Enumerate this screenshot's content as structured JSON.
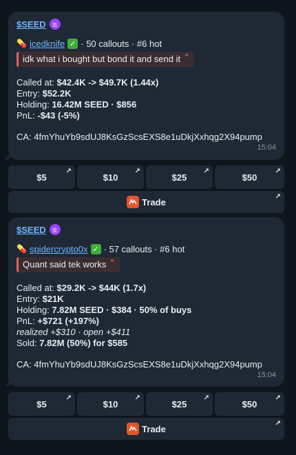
{
  "messages": [
    {
      "token": "$SEED",
      "caller_pill": "💊",
      "caller": "icedknife",
      "caller_stats": "· 50 callouts · #6 hot",
      "quote": "idk what i bought but bond it and send it",
      "quote_mark": "”",
      "called_label": "Called at:",
      "called_value": "$42.4K -> $49.7K (1.44x)",
      "entry_label": "Entry:",
      "entry_value": "$52.2K",
      "holding_label": "Holding:",
      "holding_value": "16.42M SEED · $856",
      "pnl_label": "PnL:",
      "pnl_value": "-$43 (-5%)",
      "ca": "CA: 4fmYhuYb9sdUJ8KsGzScsEXS8e1uDkjXxhqg2X94pump",
      "time": "15:04"
    },
    {
      "token": "$SEED",
      "caller_pill": "💊",
      "caller": "spidercrypto0x",
      "caller_stats": "· 57 callouts · #6 hot",
      "quote": "Quant said tek works",
      "quote_mark": "”",
      "called_label": "Called at:",
      "called_value": "$29.2K -> $44K (1.7x)",
      "entry_label": "Entry:",
      "entry_value": "$21K",
      "holding_label": "Holding:",
      "holding_value": "7.82M SEED · $384 · 50% of buys",
      "pnl_label": "PnL:",
      "pnl_value": "+$721 (+197%)",
      "realized": "realized +$310 · open +$411",
      "sold_label": "Sold:",
      "sold_value": "7.82M (50%) for $585",
      "ca": "CA: 4fmYhuYb9sdUJ8KsGzScsEXS8e1uDkjXxhqg2X94pump",
      "time": "15:04"
    }
  ],
  "buttons": {
    "amounts": [
      "$5",
      "$10",
      "$25",
      "$50"
    ],
    "trade": "Trade",
    "arrow": "↗"
  },
  "colors": {
    "background": "#0f151c",
    "bubble": "#1f2935",
    "link": "#6fb4ff",
    "quote_accent": "#e8625b",
    "solana_badge": "#9945ff",
    "trade_icon": "#e2552b"
  },
  "icons": {
    "token_badge": "solana-icon",
    "verified": "check-mark-icon",
    "caller": "pill-icon",
    "trade": "trade-brand-icon",
    "button_corner": "external-arrow-icon"
  }
}
